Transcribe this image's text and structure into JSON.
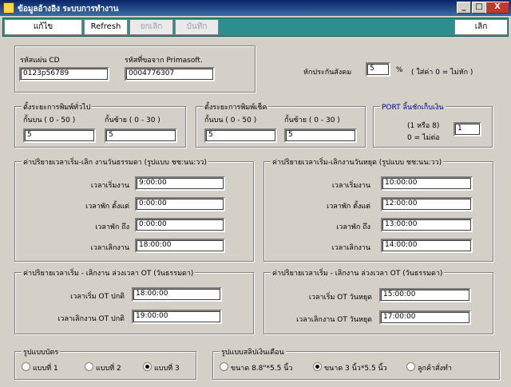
{
  "window": {
    "title": "ข้อมูลอ้างอิง ระบบการทำงาน",
    "min_label": "_",
    "max_label": "□",
    "close_label": "X"
  },
  "toolbar": {
    "edit_label": "แก้ไข",
    "refresh_label": "Refresh",
    "cancel_label": "ยกเลิก",
    "save_label": "บันทึก",
    "exit_label": "เลิก"
  },
  "ids": {
    "cd_label": "รหัสแผ่น CD",
    "cd_value": "0123p56789",
    "primasoft_label": "รหัสที่ขอจาก Primasoft.",
    "primasoft_value": "0004776307"
  },
  "social_security": {
    "label": "หักประกันสังคม",
    "value": "5",
    "unit": "%",
    "note": "( ใส่ค่า 0 = ไม่หัก )"
  },
  "print_general": {
    "title": "ตั้งระยะการพิมพ์ทั่วไป",
    "top_label": "กั้นบน ( 0 - 50 )",
    "top_value": "5",
    "left_label": "กั้นซ้าย ( 0 - 30 )",
    "left_value": "5"
  },
  "print_cheque": {
    "title": "ตั้งระยะการพิมพ์เช็ค",
    "top_label": "กั้นบน ( 0 - 50 )",
    "top_value": "5",
    "left_label": "กั้นซ้าย ( 0 - 30 )",
    "left_value": "5"
  },
  "port": {
    "title": "PORT ลิ้นชักเก็บเงิน",
    "hint1": "(1 หรือ 8)",
    "hint2": "0 = ไม่ต่อ",
    "value": "1"
  },
  "normal_day": {
    "title": "ค่าปริยายเวลาเริ่ม-เลิก งานวันธรรมดา (รูปแบบ ชช:นน:วว)",
    "start_label": "เวลาเริ่มงาน",
    "start_value": "9:00:00",
    "break_start_label": "เวลาพัก ตั้งแต่",
    "break_start_value": "0:00:00",
    "break_end_label": "เวลาพัก ถึง",
    "break_end_value": "0:00:00",
    "end_label": "เวลาเลิกงาน",
    "end_value": "18:00:00"
  },
  "holiday": {
    "title": "ค่าปริยายเวลาเริ่ม-เลิกงานวันหยุด (รูปแบบ ชช:นน:วว)",
    "start_label": "เวลาเริ่มงาน",
    "start_value": "10:00:00",
    "break_start_label": "เวลาพัก ตั้งแต่",
    "break_start_value": "12:00:00",
    "break_end_label": "เวลาพัก ถึง",
    "break_end_value": "13:00:00",
    "end_label": "เวลาเลิกงาน",
    "end_value": "14:00:00"
  },
  "ot_normal": {
    "title": "ค่าปริยายเวลาเริ่ม - เลิกงาน ล่วงเวลา OT (วันธรรมดา)",
    "start_label": "เวลาเริ่ม OT ปกติ",
    "start_value": "18:00:00",
    "end_label": "เวลาเลิกงาน OT ปกติ",
    "end_value": "19:00:00"
  },
  "ot_holiday": {
    "title": "ค่าปริยายเวลาเริ่ม - เลิกงาน ล่วงเวลา OT (วันธรรมดา)",
    "start_label": "เวลาเริ่ม OT วันหยุด",
    "start_value": "15:00:00",
    "end_label": "เวลาเลิกงาน OT วันหยุด",
    "end_value": "17:00:00"
  },
  "card_format": {
    "title": "รูปแบบบัตร",
    "options": [
      "แบบที่ 1",
      "แบบที่ 2",
      "แบบที่ 3"
    ],
    "selected": "แบบที่ 3"
  },
  "slip_format": {
    "title": "รูปแบบสลิปเงินเดือน",
    "options": [
      "ขนาด 8.8\"*5.5 นิ้ว",
      "ขนาด 3 นิ้ว*5.5 นิ้ว",
      "ลูกค้าสั่งทำ"
    ],
    "selected": "ขนาด 3 นิ้ว*5.5 นิ้ว"
  }
}
